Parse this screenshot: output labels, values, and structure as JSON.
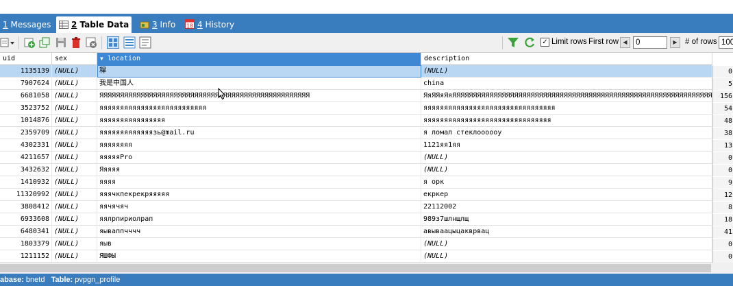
{
  "tabs": [
    {
      "num": "1",
      "label": "Messages",
      "icon": "messages-icon"
    },
    {
      "num": "2",
      "label": "Table Data",
      "icon": "table-icon"
    },
    {
      "num": "3",
      "label": "Info",
      "icon": "info-icon"
    },
    {
      "num": "4",
      "label": "History",
      "icon": "calendar-icon",
      "icon_text": "18"
    }
  ],
  "toolbar": {
    "limit_rows_label": "Limit rows",
    "limit_rows_checked": true,
    "first_row_label": "First row",
    "first_row_value": "0",
    "rows_label": "# of rows",
    "rows_value": "100",
    "filter_color": "#3aa33a",
    "refresh_color": "#3aa33a"
  },
  "columns": [
    "uid",
    "sex",
    "location",
    "description"
  ],
  "null_text": "(NULL)",
  "rows": [
    {
      "uid": "1135139",
      "sex": "(NULL)",
      "location": "稈",
      "description": "(NULL)",
      "extra": "0"
    },
    {
      "uid": "7907624",
      "sex": "(NULL)",
      "location": "我是中国人",
      "description": "china",
      "extra": "5"
    },
    {
      "uid": "6681058",
      "sex": "(NULL)",
      "location": "ЯЯЯЯЯЯЯЯЯЯЯЯЯЯЯЯЯЯЯЯЯЯЯЯЯЯЯЯЯЯЯЯЯЯЯЯЯЯЯЯЯЯЯЯЯЯЯЯЯЯЯ",
      "description": "ЯяЯЯяЯяЯЯЯЯЯЯЯЯЯЯЯЯЯЯЯЯЯЯЯЯЯЯЯЯЯЯЯЯЯЯЯЯЯЯЯЯЯЯЯЯЯЯЯЯЯЯЯЯЯЯЯЯЯЯЯЯЯЯЯЯЯЯЯЯ...",
      "extra": "156"
    },
    {
      "uid": "3523752",
      "sex": "(NULL)",
      "location": "яяяяяяяяяяяяяяяяяяяяяяяяяя",
      "description": "яяяяяяяяяяяяяяяяяяяяяяяяяяяяяяяя",
      "extra": "54"
    },
    {
      "uid": "1014876",
      "sex": "(NULL)",
      "location": "яяяяяяяяяяяяяяяя",
      "description": "яяяяяяяяяяяяяяяяяяяяяяяяяяяяяяя",
      "extra": "48"
    },
    {
      "uid": "2359709",
      "sex": "(NULL)",
      "location": "яяяяяяяяяяяяязь@mail.ru",
      "description": "я ломал стеклоооооу",
      "extra": "38"
    },
    {
      "uid": "4302331",
      "sex": "(NULL)",
      "location": "яяяяяяяя",
      "description": "1121яя1яя",
      "extra": "13"
    },
    {
      "uid": "4211657",
      "sex": "(NULL)",
      "location": "яяяяяPro",
      "description": "(NULL)",
      "extra": "0"
    },
    {
      "uid": "3432632",
      "sex": "(NULL)",
      "location": "Яяяяя",
      "description": "(NULL)",
      "extra": "0"
    },
    {
      "uid": "1410932",
      "sex": "(NULL)",
      "location": "яяяя",
      "description": "я орк",
      "extra": "9"
    },
    {
      "uid": "11320992",
      "sex": "(NULL)",
      "location": "яяячкпекрекряяяяя",
      "description": "екркер",
      "extra": "12"
    },
    {
      "uid": "3808412",
      "sex": "(NULL)",
      "location": "яячячяч",
      "description": "22112002",
      "extra": "8"
    },
    {
      "uid": "6933608",
      "sex": "(NULL)",
      "location": "яялрпириолрап",
      "description": "989з7шлнщлщ",
      "extra": "18"
    },
    {
      "uid": "6480341",
      "sex": "(NULL)",
      "location": "яываппчччч",
      "description": "авываацыцакврвац",
      "extra": "41"
    },
    {
      "uid": "1803379",
      "sex": "(NULL)",
      "location": "яыв",
      "description": "(NULL)",
      "extra": "0"
    },
    {
      "uid": "1211152",
      "sex": "(NULL)",
      "location": "ЯШФЫ",
      "description": "(NULL)",
      "extra": "0"
    }
  ],
  "status": {
    "db_label": "abase:",
    "db_value": "bnetd",
    "table_label": "Table:",
    "table_value": "pvpgn_profile"
  }
}
